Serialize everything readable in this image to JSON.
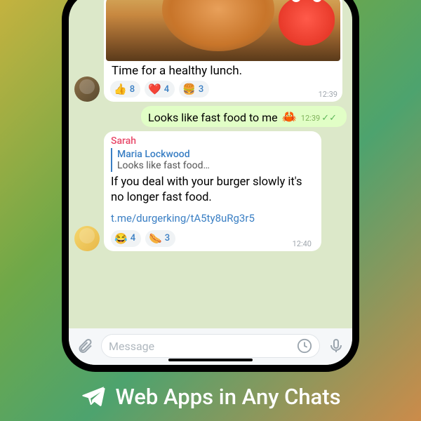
{
  "headline": "Web Apps in Any Chats",
  "chat": {
    "messages": {
      "m1": {
        "caption": "Time for a healthy lunch.",
        "reactions": [
          {
            "emoji": "👍",
            "count": 8
          },
          {
            "emoji": "❤️",
            "count": 4
          },
          {
            "emoji": "🍔",
            "count": 3
          }
        ],
        "time": "12:39"
      },
      "m2": {
        "text": "Looks like fast food to me",
        "emoji": "🦀",
        "time": "12:39"
      },
      "m3": {
        "sender": "Sarah",
        "reply_to_name": "Maria Lockwood",
        "reply_to_text": "Looks like fast food…",
        "text": "If you deal with your burger slowly it's no longer fast food.",
        "link": "t.me/durgerking/tA5ty8uRg3r5",
        "reactions": [
          {
            "emoji": "😂",
            "count": 4
          },
          {
            "emoji": "🌭",
            "count": 3
          }
        ],
        "time": "12:40"
      }
    },
    "input_placeholder": "Message"
  }
}
